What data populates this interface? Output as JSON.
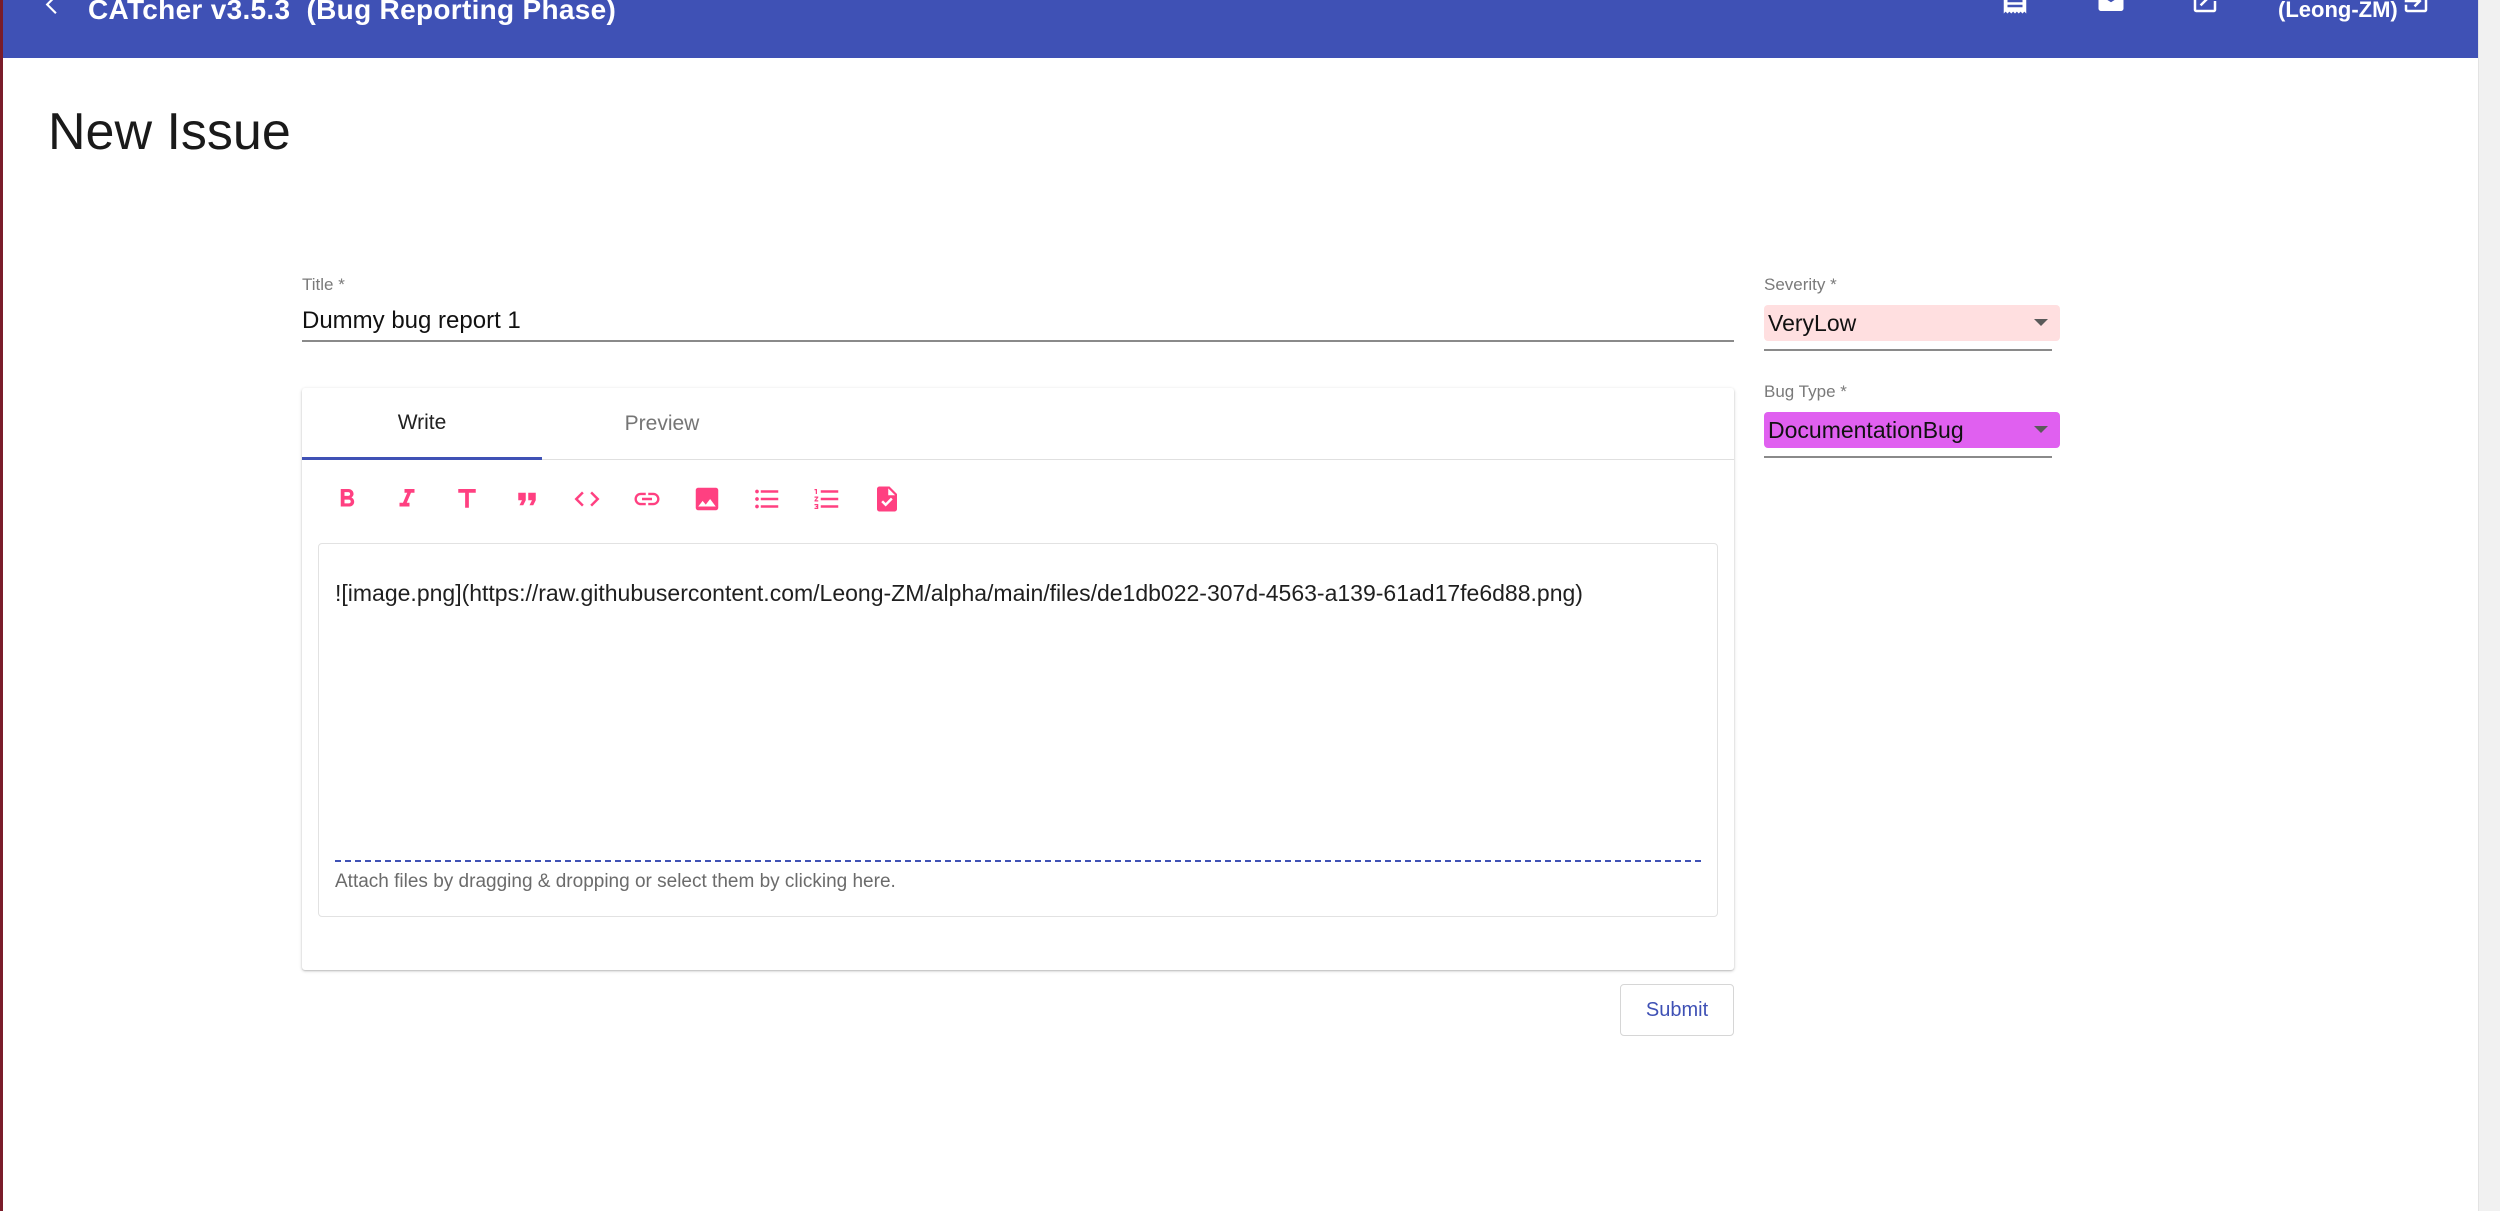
{
  "app": {
    "title": "CATcher v3.5.3  (Bug Reporting Phase)",
    "user": "(Leong-ZM)",
    "toolbar_color": "#3f51b5"
  },
  "toolbar_icons": [
    "back-arrow-icon",
    "receipt-icon",
    "mail-icon",
    "open-in-new-icon",
    "logout-icon"
  ],
  "page": {
    "title": "New Issue"
  },
  "form": {
    "title_label": "Title *",
    "title_value": "Dummy bug report 1",
    "tabs": [
      {
        "label": "Write",
        "active": true
      },
      {
        "label": "Preview",
        "active": false
      }
    ],
    "markdown_tools": [
      "bold-icon",
      "italic-icon",
      "heading-icon",
      "quote-icon",
      "code-icon",
      "link-icon",
      "image-icon",
      "bulleted-list-icon",
      "numbered-list-icon",
      "task-list-icon"
    ],
    "description": "![image.png](https://raw.githubusercontent.com/Leong-ZM/alpha/main/files/de1db022-307d-4563-a139-61ad17fe6d88.png)",
    "attach_hint": "Attach files by dragging & dropping or select them by clicking here.",
    "submit_label": "Submit",
    "accent_color": "#ff4081"
  },
  "severity": {
    "label": "Severity *",
    "value": "VeryLow",
    "color": "#ffdfe0"
  },
  "bug_type": {
    "label": "Bug Type *",
    "value": "DocumentationBug",
    "color": "#e060f0"
  }
}
